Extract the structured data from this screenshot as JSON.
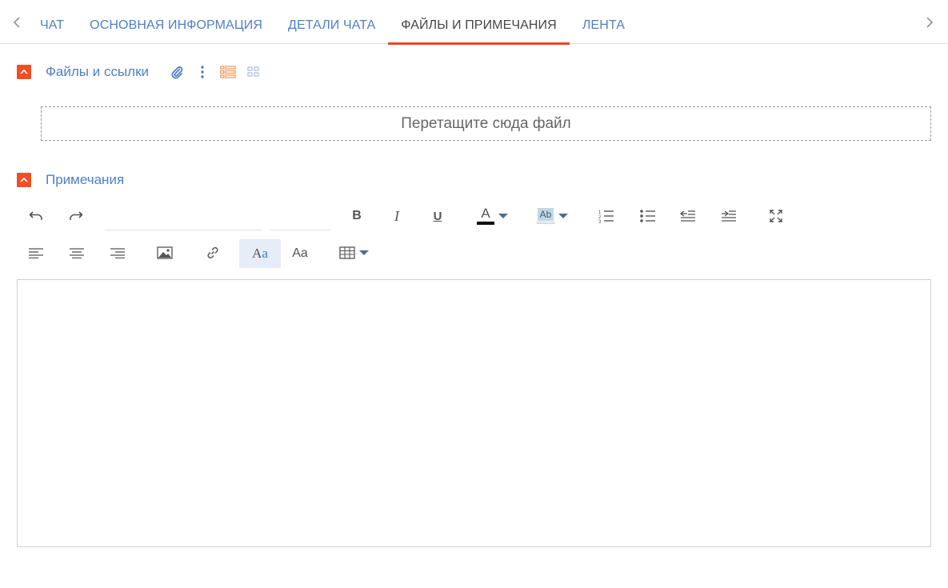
{
  "tabs": {
    "items": [
      {
        "label": "ЧАТ",
        "active": false
      },
      {
        "label": "ОСНОВНАЯ ИНФОРМАЦИЯ",
        "active": false
      },
      {
        "label": "ДЕТАЛИ ЧАТА",
        "active": false
      },
      {
        "label": "ФАЙЛЫ И ПРИМЕЧАНИЯ",
        "active": true
      },
      {
        "label": "ЛЕНТА",
        "active": false
      }
    ]
  },
  "files_section": {
    "title": "Файлы и ссылки",
    "dropzone_text": "Перетащите сюда файл"
  },
  "notes_section": {
    "title": "Примечания",
    "toolbar": {
      "serif_font_label": "Aa",
      "sans_font_label": "Aa",
      "text_color_glyph": "A",
      "highlight_glyph": "Ab",
      "bold_glyph": "B",
      "italic_glyph": "I",
      "underline_glyph": "U"
    },
    "editor_value": ""
  },
  "colors": {
    "accent": "#f04e23",
    "link": "#4f7fc7",
    "active_tab_underline": "#e8462b",
    "list_view_icon": "#f0a36b",
    "selected_button_bg": "#e6ecf8"
  },
  "icons": [
    "chevron-left-icon",
    "chevron-right-icon",
    "chevron-up-icon",
    "paperclip-icon",
    "more-vertical-icon",
    "list-view-icon",
    "tile-view-icon",
    "undo-icon",
    "redo-icon",
    "numbered-list-icon",
    "bulleted-list-icon",
    "outdent-icon",
    "indent-icon",
    "fullscreen-icon",
    "align-left-icon",
    "align-center-icon",
    "align-right-icon",
    "image-icon",
    "link-icon",
    "table-icon",
    "caret-down-icon"
  ]
}
